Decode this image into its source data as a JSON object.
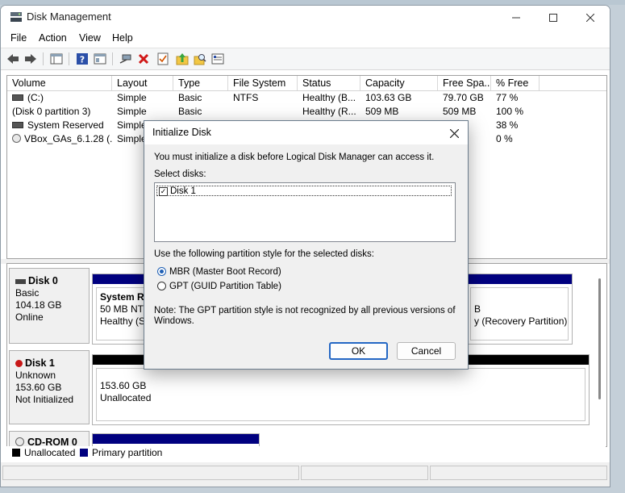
{
  "window": {
    "title": "Disk Management"
  },
  "menu": [
    "File",
    "Action",
    "View",
    "Help"
  ],
  "toolbar": [
    "back-icon",
    "forward-icon",
    "console-tree-icon",
    "help-icon",
    "properties-icon",
    "connect-icon",
    "delete-icon",
    "checklist-icon",
    "up-folder-icon",
    "search-icon",
    "settings-icon"
  ],
  "volumes": {
    "columns": [
      "Volume",
      "Layout",
      "Type",
      "File System",
      "Status",
      "Capacity",
      "Free Spa...",
      "% Free"
    ],
    "rows": [
      {
        "icon": "drive",
        "volume": "(C:)",
        "layout": "Simple",
        "type": "Basic",
        "fs": "NTFS",
        "status": "Healthy (B...",
        "capacity": "103.63 GB",
        "free": "79.70 GB",
        "pct": "77 %"
      },
      {
        "icon": "drive",
        "volume": "(Disk 0 partition 3)",
        "layout": "Simple",
        "type": "Basic",
        "fs": "",
        "status": "Healthy (R...",
        "capacity": "509 MB",
        "free": "509 MB",
        "pct": "100 %"
      },
      {
        "icon": "drive",
        "volume": "System Reserved",
        "layout": "Simple",
        "type": "",
        "fs": "",
        "status": "",
        "capacity": "",
        "free": "",
        "pct": "38 %"
      },
      {
        "icon": "cd",
        "volume": "VBox_GAs_6.1.28 (...",
        "layout": "Simple",
        "type": "",
        "fs": "",
        "status": "",
        "capacity": "",
        "free": "",
        "pct": "0 %"
      }
    ]
  },
  "disks": {
    "disk0": {
      "name": "Disk 0",
      "type": "Basic",
      "size": "104.18 GB",
      "state": "Online",
      "part1_name": "System Re",
      "part1_detail1": "50 MB NTF",
      "part1_detail2": "Healthy (S",
      "part3_detail1": "B",
      "part3_detail2": "y (Recovery Partition)"
    },
    "disk1": {
      "name": "Disk 1",
      "type": "Unknown",
      "size": "153.60 GB",
      "state": "Not Initialized",
      "part_size": "153.60 GB",
      "part_state": "Unallocated"
    },
    "cdrom": {
      "name": "CD-ROM 0"
    }
  },
  "legend": {
    "unallocated": "Unallocated",
    "primary": "Primary partition"
  },
  "colors": {
    "primary": "#00007f",
    "unallocated": "#000000",
    "accent": "#2467c4"
  },
  "dialog": {
    "title": "Initialize Disk",
    "intro": "You must initialize a disk before Logical Disk Manager can access it.",
    "select_label": "Select disks:",
    "disk_item": "Disk 1",
    "disk_checked": true,
    "style_label": "Use the following partition style for the selected disks:",
    "mbr": "MBR (Master Boot Record)",
    "gpt": "GPT (GUID Partition Table)",
    "selected_style": "MBR",
    "note_line1": "Note: The GPT partition style is not recognized by all previous versions of",
    "note_line2": "Windows.",
    "ok": "OK",
    "cancel": "Cancel"
  }
}
